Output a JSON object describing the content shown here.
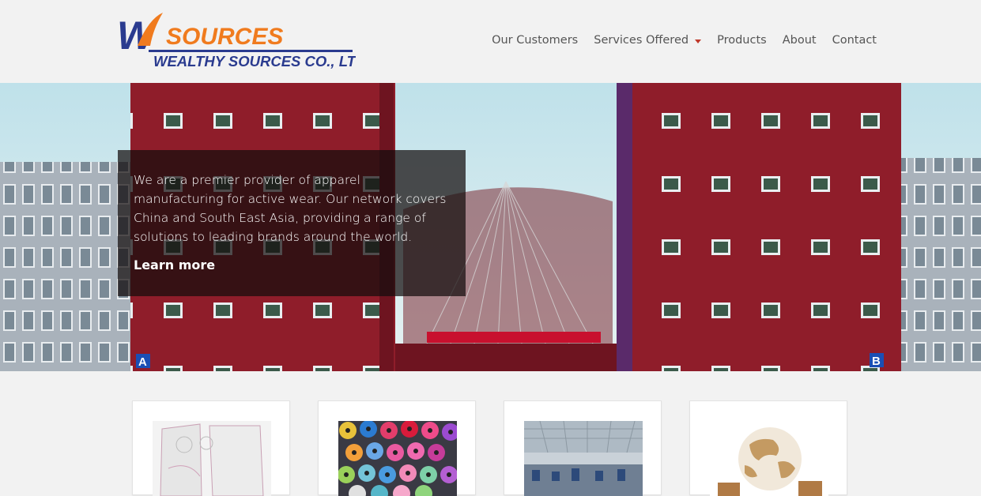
{
  "header": {
    "logo": {
      "mark": "W",
      "word": "SOURCES",
      "company": "WEALTHY SOURCES CO., LTD",
      "colors": {
        "blue": "#2a3b8f",
        "orange": "#f07b1e"
      }
    },
    "nav": [
      {
        "label": "Our Customers"
      },
      {
        "label": "Services Offered",
        "has_dropdown": true
      },
      {
        "label": "Products"
      },
      {
        "label": "About"
      },
      {
        "label": "Contact"
      }
    ]
  },
  "hero": {
    "text": "We are a premier provider of apparel manufacturing for active wear. Our network covers China and South East Asia, providing a range of solutions to leading brands around the world.",
    "link_label": "Learn more",
    "sign_left": "A",
    "sign_right": "B"
  },
  "cards": [
    {
      "image": "pattern-paper-image"
    },
    {
      "image": "thread-spools-image"
    },
    {
      "image": "factory-floor-image"
    },
    {
      "image": "globe-boxes-image"
    }
  ],
  "colors": {
    "accent": "#c0392b",
    "building_red": "#8f1d2a",
    "sky": "#cfe6ee"
  }
}
